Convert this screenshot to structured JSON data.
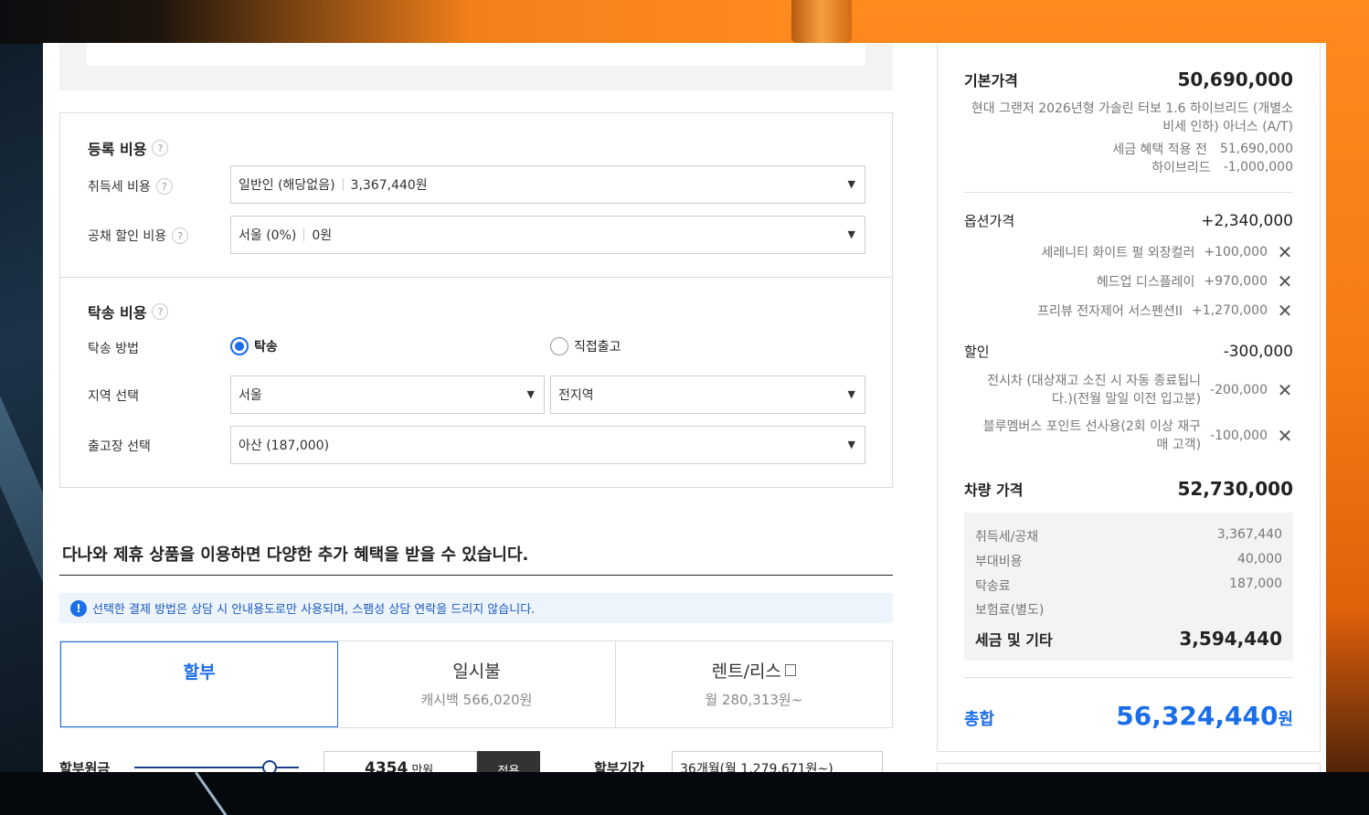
{
  "registration": {
    "title": "등록 비용",
    "acq_tax_label": "취득세 비용",
    "acq_tax_value": "일반인 (해당없음)",
    "acq_tax_amount": "3,367,440원",
    "bond_label": "공채 할인 비용",
    "bond_value": "서울 (0%)",
    "bond_amount": "0원"
  },
  "delivery": {
    "title": "탁송 비용",
    "method_label": "탁송 방법",
    "method_option_delivery": "탁송",
    "method_option_direct": "직접출고",
    "method_selected": "탁송",
    "region_label": "지역 선택",
    "region_city": "서울",
    "region_district": "전지역",
    "factory_label": "출고장 선택",
    "factory_value": "아산 (187,000)"
  },
  "partner": {
    "title": "다나와 제휴 상품을 이용하면 다양한 추가 혜택을 받을 수 있습니다.",
    "notice": "선택한 결제 방법은 상담 시 안내용도로만 사용되며, 스팸성 상담 연락을 드리지 않습니다.",
    "tabs": [
      {
        "label": "할부",
        "sub": ""
      },
      {
        "label": "일시불",
        "sub": "캐시백 566,020원"
      },
      {
        "label": "렌트/리스",
        "sub": "월 280,313원~"
      }
    ],
    "installment_principal_label": "할부원금",
    "principal_value": "4354",
    "principal_unit": "만원",
    "apply_label": "적용",
    "term_label": "할부기간",
    "term_value": "36개월(월 1,279,671원~)"
  },
  "summary": {
    "base_label": "기본가격",
    "base_value": "50,690,000",
    "base_model": "현대 그랜저 2026년형 가솔린 터보 1.6 하이브리드 (개별소비세 인하) 아너스 (A/T)",
    "pre_tax_label": "세금 혜택 적용 전",
    "pre_tax_value": "51,690,000",
    "hybrid_label": "하이브리드",
    "hybrid_value": "-1,000,000",
    "options_label": "옵션가격",
    "options_value": "+2,340,000",
    "options": [
      {
        "name": "세레니티 화이트 펄 외장컬러",
        "price": "+100,000"
      },
      {
        "name": "헤드업 디스플레이",
        "price": "+970,000"
      },
      {
        "name": "프리뷰 전자제어 서스펜션II",
        "price": "+1,270,000"
      }
    ],
    "discount_label": "할인",
    "discount_value": "-300,000",
    "discounts": [
      {
        "name": "전시차 (대상재고 소진 시 자동 종료됩니다.)(전월 말일 이전 입고분)",
        "price": "-200,000"
      },
      {
        "name": "블루멤버스 포인트 선사용(2회 이상 재구매 고객)",
        "price": "-100,000"
      }
    ],
    "vehicle_label": "차량 가격",
    "vehicle_value": "52,730,000",
    "taxes": [
      {
        "name": "취득세/공채",
        "value": "3,367,440"
      },
      {
        "name": "부대비용",
        "value": "40,000"
      },
      {
        "name": "탁송료",
        "value": "187,000"
      },
      {
        "name": "보험료(별도)",
        "value": ""
      }
    ],
    "tax_total_label": "세금 및 기타",
    "tax_total_value": "3,594,440",
    "total_label": "총합",
    "total_value": "56,324,440",
    "total_unit": "원"
  },
  "colors": {
    "accent": "#1a6ee8",
    "border": "#dddddd"
  }
}
